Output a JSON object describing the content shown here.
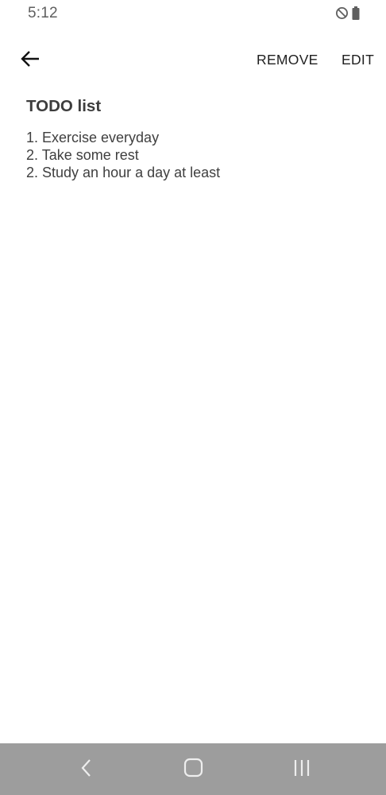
{
  "status_bar": {
    "time": "5:12",
    "icons": [
      "do-not-disturb-icon",
      "battery-icon"
    ]
  },
  "app_bar": {
    "back_icon": "arrow-back-icon",
    "remove_label": "REMOVE",
    "edit_label": "EDIT"
  },
  "note": {
    "title": "TODO list",
    "lines": [
      "1. Exercise everyday",
      "2. Take some rest",
      "2. Study an hour a day at least"
    ]
  },
  "nav_bar": {
    "background": "#9d9d9d",
    "icons": [
      "nav-back-icon",
      "nav-home-icon",
      "nav-recents-icon"
    ]
  }
}
